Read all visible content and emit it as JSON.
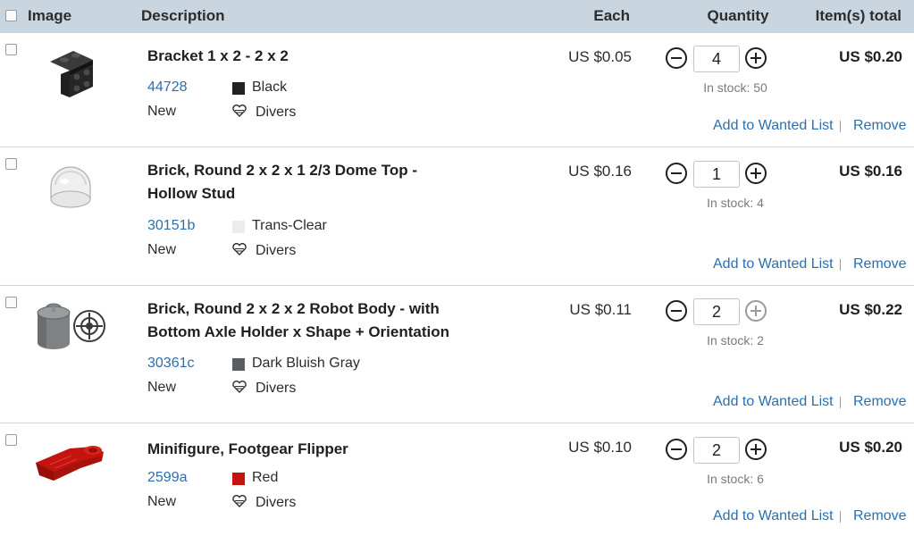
{
  "header": {
    "image": "Image",
    "description": "Description",
    "each": "Each",
    "quantity": "Quantity",
    "total": "Item(s) total"
  },
  "items": [
    {
      "title": "Bracket 1 x 2 - 2 x 2",
      "part_no": "44728",
      "color": "Black",
      "color_hex": "#212121",
      "condition": "New",
      "seller": "Divers",
      "price": "US $0.05",
      "quantity": "4",
      "stock": "In stock: 50",
      "total": "US $0.20",
      "wanted": "Add to Wanted List",
      "remove": "Remove"
    },
    {
      "title": "Brick, Round 2 x 2 x 1 2/3 Dome Top - Hollow Stud",
      "part_no": "30151b",
      "color": "Trans-Clear",
      "color_hex": "#ececec",
      "condition": "New",
      "seller": "Divers",
      "price": "US $0.16",
      "quantity": "1",
      "stock": "In stock: 4",
      "total": "US $0.16",
      "wanted": "Add to Wanted List",
      "remove": "Remove"
    },
    {
      "title": "Brick, Round 2 x 2 x 2 Robot Body - with Bottom Axle Holder x Shape + Orientation",
      "part_no": "30361c",
      "color": "Dark Bluish Gray",
      "color_hex": "#595d60",
      "condition": "New",
      "seller": "Divers",
      "price": "US $0.11",
      "quantity": "2",
      "stock": "In stock: 2",
      "total": "US $0.22",
      "wanted": "Add to Wanted List",
      "remove": "Remove"
    },
    {
      "title": "Minifigure, Footgear Flipper",
      "part_no": "2599a",
      "color": "Red",
      "color_hex": "#c4140f",
      "condition": "New",
      "seller": "Divers",
      "price": "US $0.10",
      "quantity": "2",
      "stock": "In stock: 6",
      "total": "US $0.20",
      "wanted": "Add to Wanted List",
      "remove": "Remove"
    }
  ]
}
